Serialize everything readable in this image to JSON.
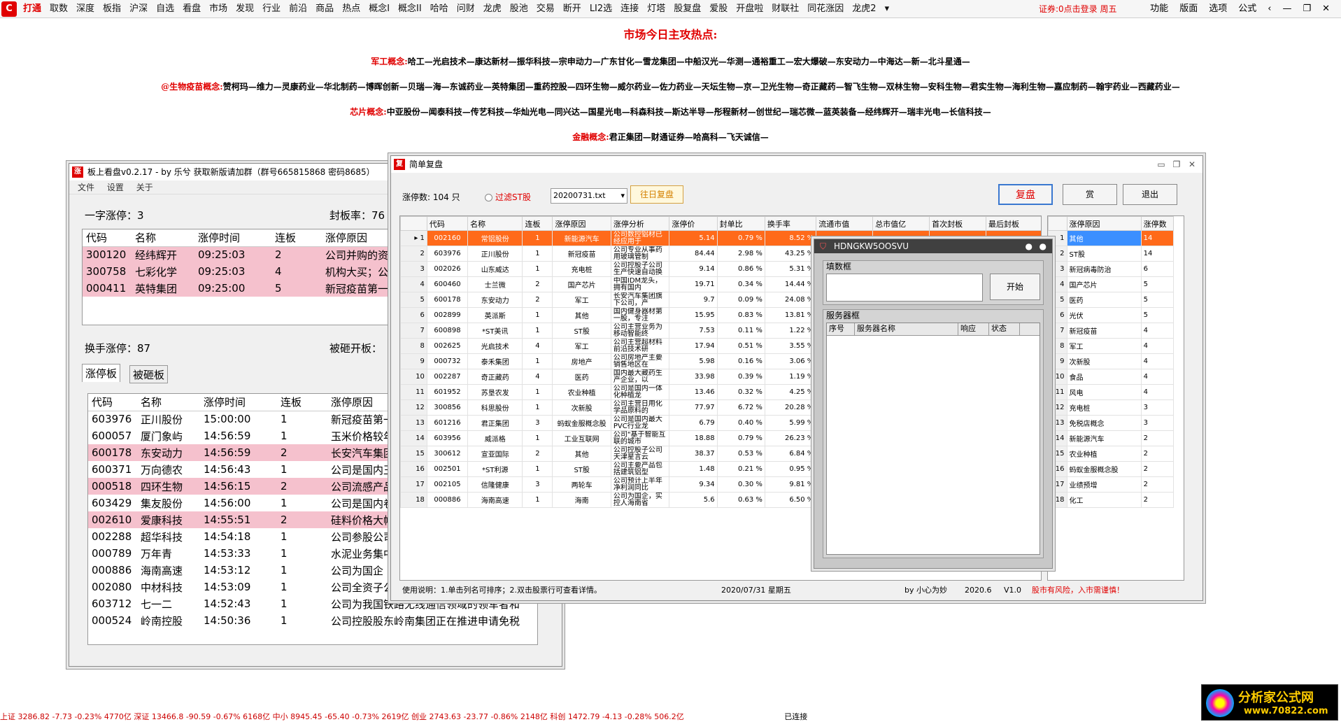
{
  "topbar": {
    "menus": [
      "打通",
      "取数",
      "深度",
      "板指",
      "沪深",
      "自选",
      "看盘",
      "市场",
      "发现",
      "行业",
      "前沿",
      "商品",
      "热点",
      "概念I",
      "概念II",
      "哈哈",
      "问财",
      "龙虎",
      "股池",
      "交易",
      "断开",
      "LI2选",
      "连接",
      "灯塔",
      "股复盘",
      "爱股",
      "开盘啦",
      "财联社",
      "同花涨因",
      "龙虎2"
    ],
    "login": "证券:0点击登录 周五",
    "right": [
      "功能",
      "版面",
      "选项",
      "公式"
    ]
  },
  "hot": {
    "title": "市场今日主攻热点:",
    "rows": [
      {
        "label": "军工概念:",
        "text": "哈工—光启技术—康达新材—振华科技—宗申动力—广东甘化—雪龙集团—中船汉光—华测—通裕重工—宏大爆破—东安动力—中海达—新—北斗星通—"
      },
      {
        "label": "@生物疫苗概念:",
        "text": "赞柯玛—维力—灵康药业—华北制药—博晖创新—贝瑞—海—东诚药业—英特集团—重药控股—四环生物—威尔药业—佐力药业—天坛生物—京—卫光生物—奇正藏药—智飞生物—双林生物—安科生物—君实生物—海利生物—嘉应制药—翰宇药业—西藏药业—"
      },
      {
        "label": "芯片概念:",
        "text": "中亚股份—闻泰科技—传艺科技—华灿光电—同兴达—国星光电—科森科技—斯达半导—彤程新材—创世纪—瑞芯微—蓝英装备—经纬辉开—瑞丰光电—长信科技—"
      },
      {
        "label": "金融概念:",
        "text": "君正集团—财通证券—哈高科—飞天诚信—"
      }
    ]
  },
  "w1": {
    "title": "板上看盘v0.2.17 - by 乐兮 获取新版请加群（群号665815868 密码8685）",
    "menu": [
      "文件",
      "设置",
      "关于"
    ],
    "yizi": "一字涨停：3",
    "fengban": "封板率：76",
    "cols": [
      "代码",
      "名称",
      "涨停时间",
      "连板",
      "涨停原因"
    ],
    "top_rows": [
      [
        "300120",
        "经纬辉开",
        "09:25:03",
        "2",
        "公司并购的资"
      ],
      [
        "300758",
        "七彩化学",
        "09:25:03",
        "4",
        "机构大买；公"
      ],
      [
        "000411",
        "英特集团",
        "09:25:00",
        "5",
        "新冠疫苗第一"
      ]
    ],
    "huanshou": "换手涨停：87",
    "beiza": "被砸开板：",
    "tabs": [
      "涨停板",
      "被砸板"
    ],
    "rows": [
      [
        "603976",
        "正川股份",
        "15:00:00",
        "1",
        "新冠疫苗第一"
      ],
      [
        "600057",
        "厦门象屿",
        "14:56:59",
        "1",
        "玉米价格较年"
      ],
      [
        "600178",
        "东安动力",
        "14:56:59",
        "2",
        "长安汽车集团"
      ],
      [
        "600371",
        "万向德农",
        "14:56:43",
        "1",
        "公司是国内玉"
      ],
      [
        "000518",
        "四环生物",
        "14:56:15",
        "2",
        "公司流感产品"
      ],
      [
        "603429",
        "集友股份",
        "14:56:00",
        "1",
        "公司是国内卷"
      ],
      [
        "002610",
        "爱康科技",
        "14:55:51",
        "2",
        "硅料价格大幅"
      ],
      [
        "002288",
        "超华科技",
        "14:54:18",
        "1",
        "公司参股公司"
      ],
      [
        "000789",
        "万年青",
        "14:53:33",
        "1",
        "水泥业务集中"
      ],
      [
        "000886",
        "海南高速",
        "14:53:12",
        "1",
        "公司为国企"
      ],
      [
        "002080",
        "中材科技",
        "14:53:09",
        "1",
        "公司全资子公"
      ],
      [
        "603712",
        "七一二",
        "14:52:43",
        "1",
        "公司为我国铁路无线通信领域的领军者和"
      ],
      [
        "000524",
        "岭南控股",
        "14:50:36",
        "1",
        "公司控股股东岭南集团正在推进申请免税"
      ]
    ]
  },
  "w2": {
    "title": "简单复盘",
    "zhangting": "涨停数: 104 只",
    "filter": "过滤ST股",
    "file": "20200731.txt",
    "prev": "往日复盘",
    "btn_fupan": "复盘",
    "btn_shang": "赏",
    "btn_exit": "退出",
    "cols": [
      "代码",
      "名称",
      "连板",
      "涨停原因",
      "涨停分析",
      "涨停价",
      "封单比",
      "换手率",
      "流通市值",
      "总市值亿",
      "首次封板",
      "最后封板",
      "开板"
    ],
    "rows": [
      [
        "002160",
        "常铝股份",
        "1",
        "新能源汽车",
        "公司数控铝材已经应用于",
        "5.14",
        "0.79 %",
        "8.52 %"
      ],
      [
        "603976",
        "正川股份",
        "1",
        "新冠疫苗",
        "公司专业从事药用玻璃管制",
        "84.44",
        "2.98 %",
        "43.25 %"
      ],
      [
        "002026",
        "山东威达",
        "1",
        "充电桩",
        "公司控股子公司生产快速自动换",
        "9.14",
        "0.86 %",
        "5.31 %"
      ],
      [
        "600460",
        "士兰微",
        "2",
        "国产芯片",
        "中国IDM龙头，拥有国内",
        "19.71",
        "0.34 %",
        "14.44 %"
      ],
      [
        "600178",
        "东安动力",
        "2",
        "军工",
        "长安汽车集团旗下公司，产",
        "9.7",
        "0.09 %",
        "24.08 %"
      ],
      [
        "002899",
        "英派斯",
        "1",
        "其他",
        "国内健身器材第一股，专注",
        "15.95",
        "0.83 %",
        "13.81 %"
      ],
      [
        "600898",
        "*ST美讯",
        "1",
        "ST股",
        "公司主营业务为移动智能终",
        "7.53",
        "0.11 %",
        "1.22 %"
      ],
      [
        "002625",
        "光启技术",
        "4",
        "军工",
        "公司主营超材料前沿技术研",
        "17.94",
        "0.51 %",
        "3.55 %"
      ],
      [
        "000732",
        "泰禾集团",
        "1",
        "房地产",
        "公司房地产主要销售地区在",
        "5.98",
        "0.16 %",
        "3.06 %"
      ],
      [
        "002287",
        "奇正藏药",
        "4",
        "医药",
        "国内最大藏药生产企业，以",
        "33.98",
        "0.39 %",
        "1.19 %"
      ],
      [
        "601952",
        "苏垦农发",
        "1",
        "农业种植",
        "公司是国内一体化种植龙",
        "13.46",
        "0.32 %",
        "4.25 %"
      ],
      [
        "300856",
        "科思股份",
        "1",
        "次新股",
        "公司主营日用化学品原料的",
        "77.97",
        "6.72 %",
        "20.28 %"
      ],
      [
        "601216",
        "君正集团",
        "3",
        "蚂蚁金服概念股",
        "公司是国内最大PVC行业龙",
        "6.79",
        "0.40 %",
        "5.99 %"
      ],
      [
        "603956",
        "威派格",
        "1",
        "工业互联网",
        "公司\"基于智能互联的城市",
        "18.88",
        "0.79 %",
        "26.23 %"
      ],
      [
        "300612",
        "宣亚国际",
        "2",
        "其他",
        "公司控股子公司天津星言云",
        "38.37",
        "0.53 %",
        "6.84 %"
      ],
      [
        "002501",
        "*ST利源",
        "1",
        "ST股",
        "公司主要产品包括建筑铝型",
        "1.48",
        "0.21 %",
        "0.95 %"
      ],
      [
        "002105",
        "信隆健康",
        "3",
        "两轮车",
        "公司预计上半年净利润同比",
        "9.34",
        "0.30 %",
        "9.81 %"
      ],
      [
        "000886",
        "海南高速",
        "1",
        "海南",
        "公司为国企，实控人海南省",
        "5.6",
        "0.63 %",
        "6.50 %"
      ]
    ],
    "side_cols": [
      "涨停原因",
      "涨停数"
    ],
    "side": [
      [
        "其他",
        "14"
      ],
      [
        "ST股",
        "14"
      ],
      [
        "新冠病毒防治",
        "6"
      ],
      [
        "国产芯片",
        "5"
      ],
      [
        "医药",
        "5"
      ],
      [
        "光伏",
        "5"
      ],
      [
        "新冠疫苗",
        "4"
      ],
      [
        "军工",
        "4"
      ],
      [
        "次新股",
        "4"
      ],
      [
        "食品",
        "4"
      ],
      [
        "风电",
        "4"
      ],
      [
        "充电桩",
        "3"
      ],
      [
        "免税店概念",
        "3"
      ],
      [
        "新能源汽车",
        "2"
      ],
      [
        "农业种植",
        "2"
      ],
      [
        "蚂蚁金服概念股",
        "2"
      ],
      [
        "业绩预增",
        "2"
      ],
      [
        "化工",
        "2"
      ]
    ],
    "status": {
      "usage": "使用说明：1.单击列名可排序；2.双击股票行可查看详情。",
      "date": "2020/07/31 星期五",
      "author": "by 小心为妙",
      "ver1": "2020.6",
      "ver2": "V1.0",
      "warn": "股市有风险，入市需谨慎！"
    }
  },
  "w3": {
    "title": "HDNGKW5OOSVU",
    "fill_label": "填数框",
    "start": "开始",
    "server_label": "服务器框",
    "cols": [
      "序号",
      "服务器名称",
      "响应",
      "状态"
    ]
  },
  "statusbar": "上证 3286.82 -7.73 -0.23% 4770亿 深证 13466.8 -90.59 -0.67% 6168亿 中小 8945.45 -65.40 -0.73% 2619亿 创业 2743.63 -23.77 -0.86% 2148亿 科创 1472.79 -4.13 -0.28% 506.2亿",
  "status_connected": "已连接",
  "watermark": {
    "text": "分析家公式网",
    "url": "www.70822.com"
  }
}
